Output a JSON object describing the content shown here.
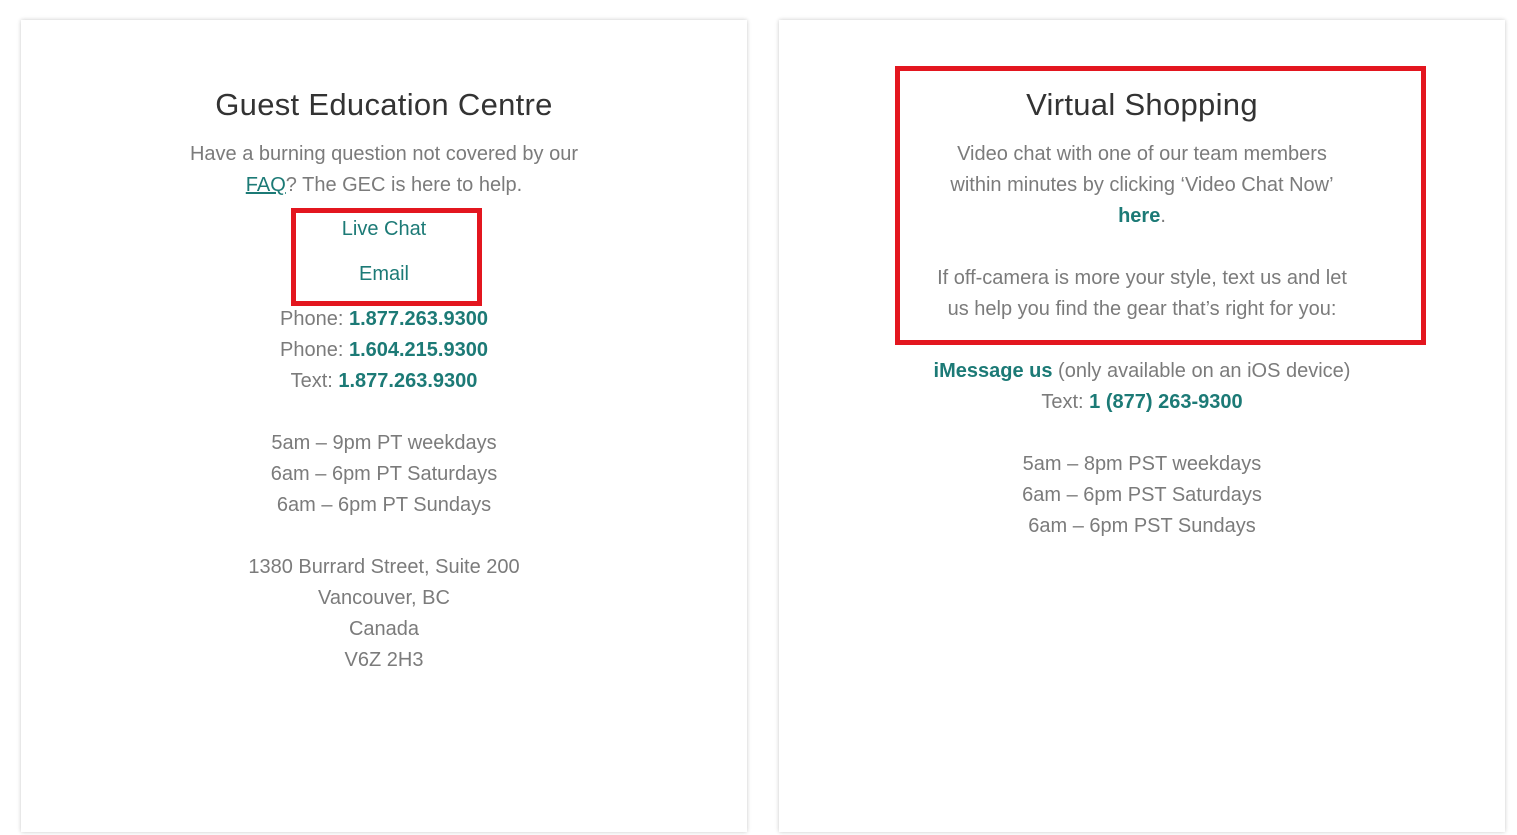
{
  "left_card": {
    "title": "Guest Education Centre",
    "intro_line1": "Have a burning question not covered by our",
    "faq_link": "FAQ",
    "intro_line2_rest": "? The GEC is here to help.",
    "live_chat": "Live Chat",
    "email": "Email",
    "contacts": [
      {
        "label": "Phone: ",
        "value": "1.877.263.9300"
      },
      {
        "label": "Phone: ",
        "value": "1.604.215.9300"
      },
      {
        "label": "Text: ",
        "value": "1.877.263.9300"
      }
    ],
    "hours": [
      "5am – 9pm PT weekdays",
      "6am – 6pm PT Saturdays",
      "6am – 6pm PT Sundays"
    ],
    "address": [
      "1380 Burrard Street, Suite 200",
      "Vancouver, BC",
      "Canada",
      "V6Z 2H3"
    ]
  },
  "right_card": {
    "title": "Virtual Shopping",
    "video_line1": "Video chat with one of our team members",
    "video_line2": "within minutes by clicking ‘Video Chat Now’",
    "here_link": "here",
    "here_suffix": ".",
    "text_line1": "If off-camera is more your style, text us and let",
    "text_line2": "us help you find the gear that’s right for you:",
    "imessage_link": "iMessage us",
    "imessage_note": " (only available on an iOS device)",
    "text_label": "Text: ",
    "text_number": "1 (877) 263-9300",
    "hours": [
      "5am – 8pm PST weekdays",
      "6am – 6pm PST Saturdays",
      "6am – 6pm PST Sundays"
    ]
  },
  "colors": {
    "teal": "#1c7a76",
    "gray_text": "#7b7b7b",
    "title_text": "#333333",
    "highlight_red": "#e3161f"
  }
}
